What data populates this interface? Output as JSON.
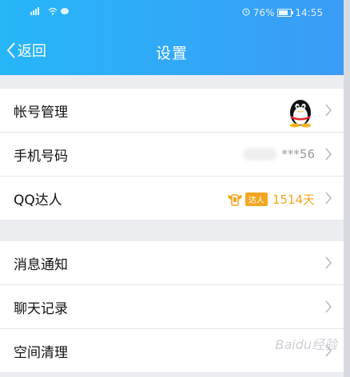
{
  "status": {
    "battery": "76%",
    "time": "14:55"
  },
  "header": {
    "back_label": "返回",
    "title": "设置"
  },
  "group1": [
    {
      "label": "帐号管理"
    },
    {
      "label": "手机号码",
      "value": "***56"
    },
    {
      "label": "QQ达人",
      "badge": "达人",
      "days": "1514天"
    }
  ],
  "group2": [
    {
      "label": "消息通知"
    },
    {
      "label": "聊天记录"
    },
    {
      "label": "空间清理"
    }
  ],
  "watermark": "Baidu经验"
}
